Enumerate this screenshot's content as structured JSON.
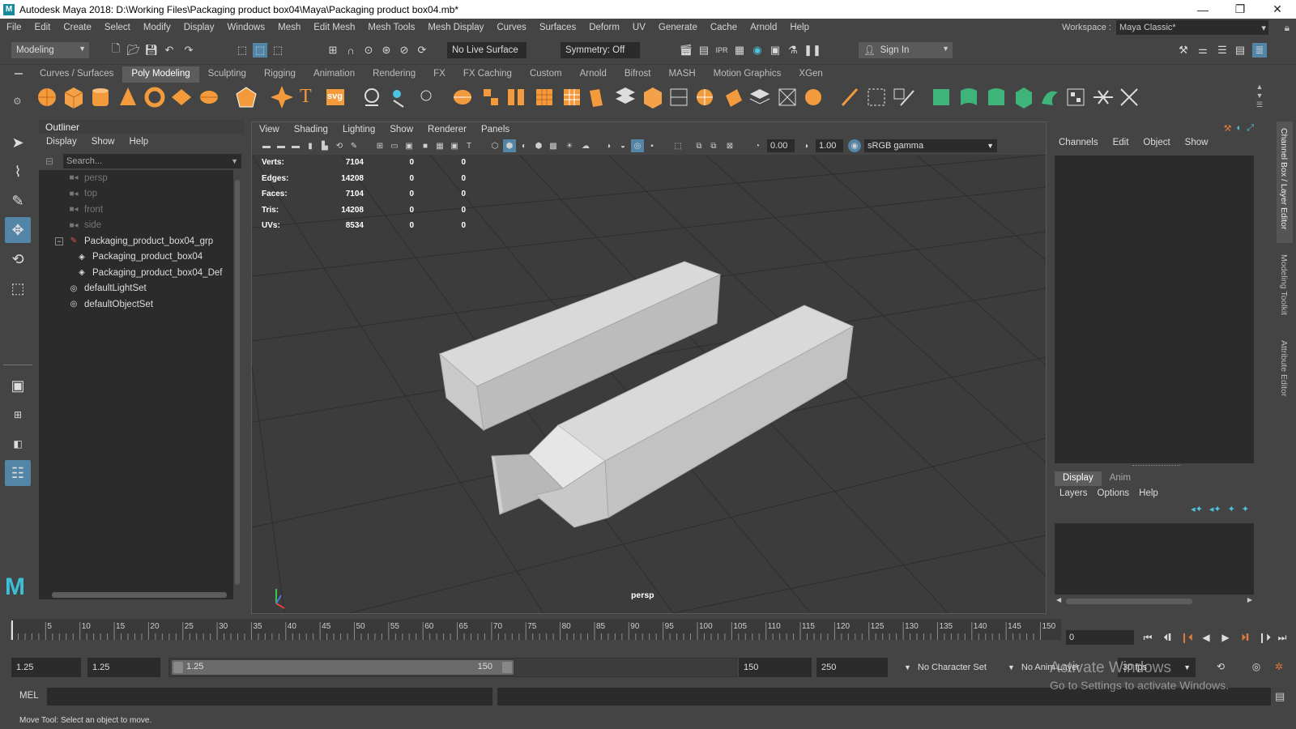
{
  "window": {
    "title": "Autodesk Maya 2018: D:\\Working Files\\Packaging product box04\\Maya\\Packaging product box04.mb*",
    "controls": [
      "—",
      "❐",
      "✕"
    ]
  },
  "menubar": {
    "items": [
      "File",
      "Edit",
      "Create",
      "Select",
      "Modify",
      "Display",
      "Windows",
      "Mesh",
      "Edit Mesh",
      "Mesh Tools",
      "Mesh Display",
      "Curves",
      "Surfaces",
      "Deform",
      "UV",
      "Generate",
      "Cache",
      "Arnold",
      "Help"
    ],
    "workspace_label": "Workspace :",
    "workspace_value": "Maya Classic*"
  },
  "statusline": {
    "menuset": "Modeling",
    "live_surface": "No Live Surface",
    "symmetry": "Symmetry: Off",
    "sign_in": "Sign In"
  },
  "shelf": {
    "tabs": [
      "Curves / Surfaces",
      "Poly Modeling",
      "Sculpting",
      "Rigging",
      "Animation",
      "Rendering",
      "FX",
      "FX Caching",
      "Custom",
      "Arnold",
      "Bifrost",
      "MASH",
      "Motion Graphics",
      "XGen"
    ],
    "active_tab": "Poly Modeling",
    "text_icon": "T",
    "svg_icon": "svg"
  },
  "outliner": {
    "title": "Outliner",
    "menus": [
      "Display",
      "Show",
      "Help"
    ],
    "search_placeholder": "Search...",
    "nodes": {
      "persp": "persp",
      "top": "top",
      "front": "front",
      "side": "side",
      "group": "Packaging_product_box04_grp",
      "child1": "Packaging_product_box04",
      "child2": "Packaging_product_box04_Def",
      "lightset": "defaultLightSet",
      "objectset": "defaultObjectSet"
    }
  },
  "viewport": {
    "menus": [
      "View",
      "Shading",
      "Lighting",
      "Show",
      "Renderer",
      "Panels"
    ],
    "exposure": "0.00",
    "gamma": "1.00",
    "colorspace": "sRGB gamma",
    "camera": "persp",
    "hud": [
      {
        "label": "Verts:",
        "v1": "7104",
        "v2": "0",
        "v3": "0"
      },
      {
        "label": "Edges:",
        "v1": "14208",
        "v2": "0",
        "v3": "0"
      },
      {
        "label": "Faces:",
        "v1": "7104",
        "v2": "0",
        "v3": "0"
      },
      {
        "label": "Tris:",
        "v1": "14208",
        "v2": "0",
        "v3": "0"
      },
      {
        "label": "UVs:",
        "v1": "8534",
        "v2": "0",
        "v3": "0"
      }
    ]
  },
  "channelbox": {
    "menus": [
      "Channels",
      "Edit",
      "Object",
      "Show"
    ],
    "layer_tabs": [
      "Display",
      "Anim"
    ],
    "layer_menus": [
      "Layers",
      "Options",
      "Help"
    ],
    "side_tabs": [
      "Channel Box / Layer Editor",
      "Modeling Toolkit",
      "Attribute Editor"
    ]
  },
  "timeline": {
    "ticks": [
      "5",
      "10",
      "15",
      "20",
      "25",
      "30",
      "35",
      "40",
      "45",
      "50",
      "55",
      "60",
      "65",
      "70",
      "75",
      "80",
      "85",
      "90",
      "95",
      "100",
      "105",
      "110",
      "115",
      "120",
      "125",
      "130",
      "135",
      "140",
      "145",
      "150"
    ],
    "current_frame": "0"
  },
  "range": {
    "start": "1.25",
    "start_inner": "1.25",
    "slider_left": "1.25",
    "slider_right": "150",
    "end_inner": "150",
    "end": "250",
    "character_set": "No Character Set",
    "anim_layer": "No Anim Layer",
    "fps": "30 fps"
  },
  "cmd": {
    "label": "MEL",
    "help": "Move Tool: Select an object to move."
  },
  "watermark": {
    "line1": "Activate Windows",
    "line2": "Go to Settings to activate Windows."
  }
}
